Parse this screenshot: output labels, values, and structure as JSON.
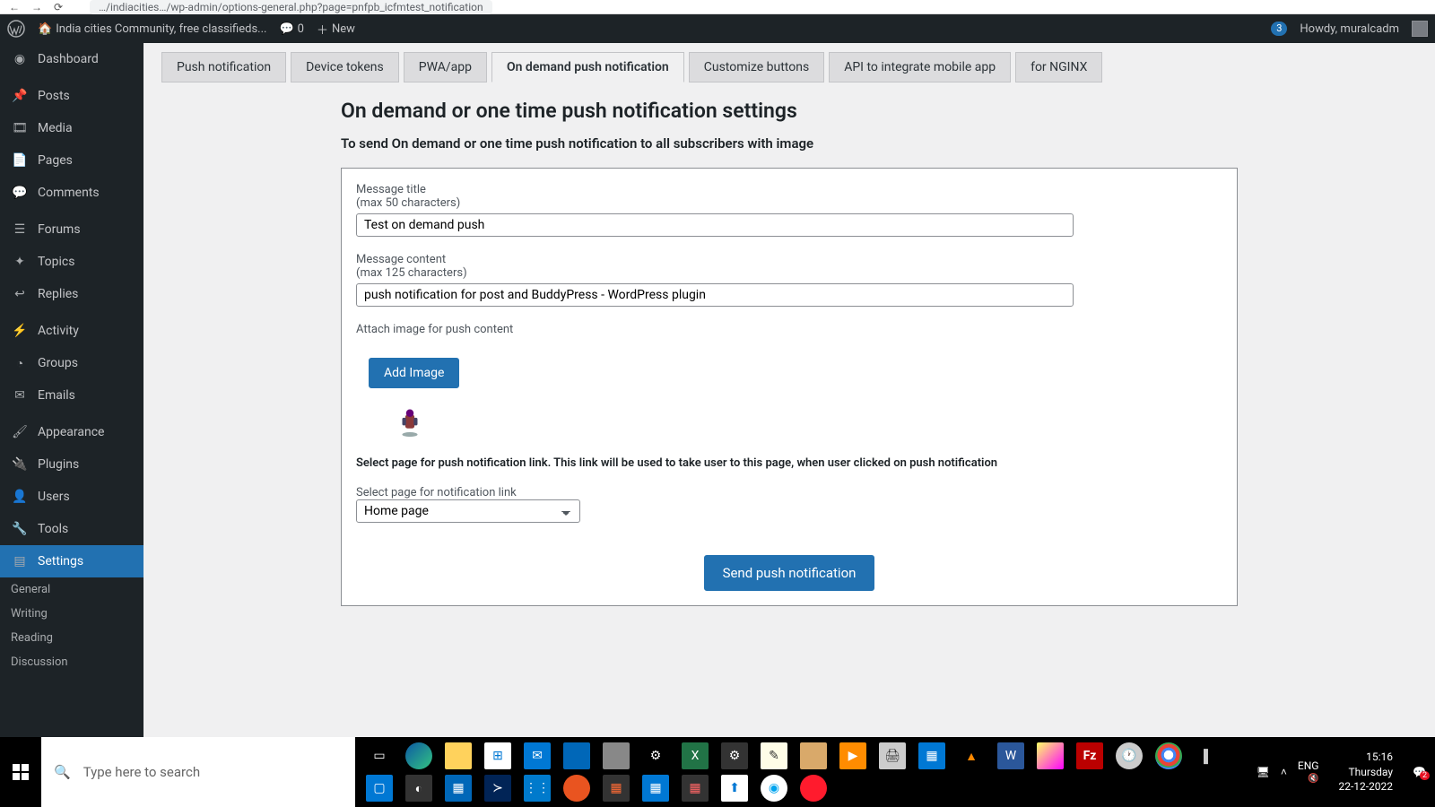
{
  "browser": {
    "url": "…/indiacities…/wp-admin/options-general.php?page=pnfpb_icfmtest_notification"
  },
  "adminbar": {
    "site_name": "India cities Community, free classifieds...",
    "comments_count": "0",
    "new_label": "New",
    "howdy": "Howdy, muralcadm",
    "notif_count": "3"
  },
  "sidebar": {
    "items": [
      {
        "label": "Dashboard",
        "icon": "dashboard"
      },
      {
        "label": "Posts",
        "icon": "pin"
      },
      {
        "label": "Media",
        "icon": "media"
      },
      {
        "label": "Pages",
        "icon": "page"
      },
      {
        "label": "Comments",
        "icon": "comment"
      },
      {
        "label": "Forums",
        "icon": "forums"
      },
      {
        "label": "Topics",
        "icon": "topics"
      },
      {
        "label": "Replies",
        "icon": "replies"
      },
      {
        "label": "Activity",
        "icon": "activity"
      },
      {
        "label": "Groups",
        "icon": "groups"
      },
      {
        "label": "Emails",
        "icon": "email"
      },
      {
        "label": "Appearance",
        "icon": "brush"
      },
      {
        "label": "Plugins",
        "icon": "plug"
      },
      {
        "label": "Users",
        "icon": "user"
      },
      {
        "label": "Tools",
        "icon": "wrench"
      },
      {
        "label": "Settings",
        "icon": "settings",
        "current": true
      }
    ],
    "subitems": [
      "General",
      "Writing",
      "Reading",
      "Discussion"
    ]
  },
  "tabs": [
    {
      "label": "Push notification"
    },
    {
      "label": "Device tokens"
    },
    {
      "label": "PWA/app"
    },
    {
      "label": "On demand push notification",
      "active": true
    },
    {
      "label": "Customize buttons"
    },
    {
      "label": "API to integrate mobile app"
    },
    {
      "label": "for NGINX"
    }
  ],
  "page": {
    "title": "On demand or one time push notification settings",
    "subtitle": "To send On demand or one time push notification to all subscribers with image",
    "message_title_label": "Message title",
    "message_title_hint": "(max 50 characters)",
    "message_title_value": "Test on demand push",
    "message_content_label": "Message content",
    "message_content_hint": "(max 125 characters)",
    "message_content_value": "push notification for post and BuddyPress - WordPress plugin",
    "attach_image_label": "Attach image for push content",
    "add_image_button": "Add Image",
    "select_page_text": "Select page for push notification link. This link will be used to take user to this page, when user clicked on push notification",
    "select_page_label": "Select page for notification link",
    "select_page_value": "Home page",
    "send_button": "Send push notification"
  },
  "taskbar": {
    "search_placeholder": "Type here to search",
    "lang": "ENG",
    "time": "15:16",
    "day": "Thursday",
    "date": "22-12-2022",
    "notif_badge": "2"
  }
}
